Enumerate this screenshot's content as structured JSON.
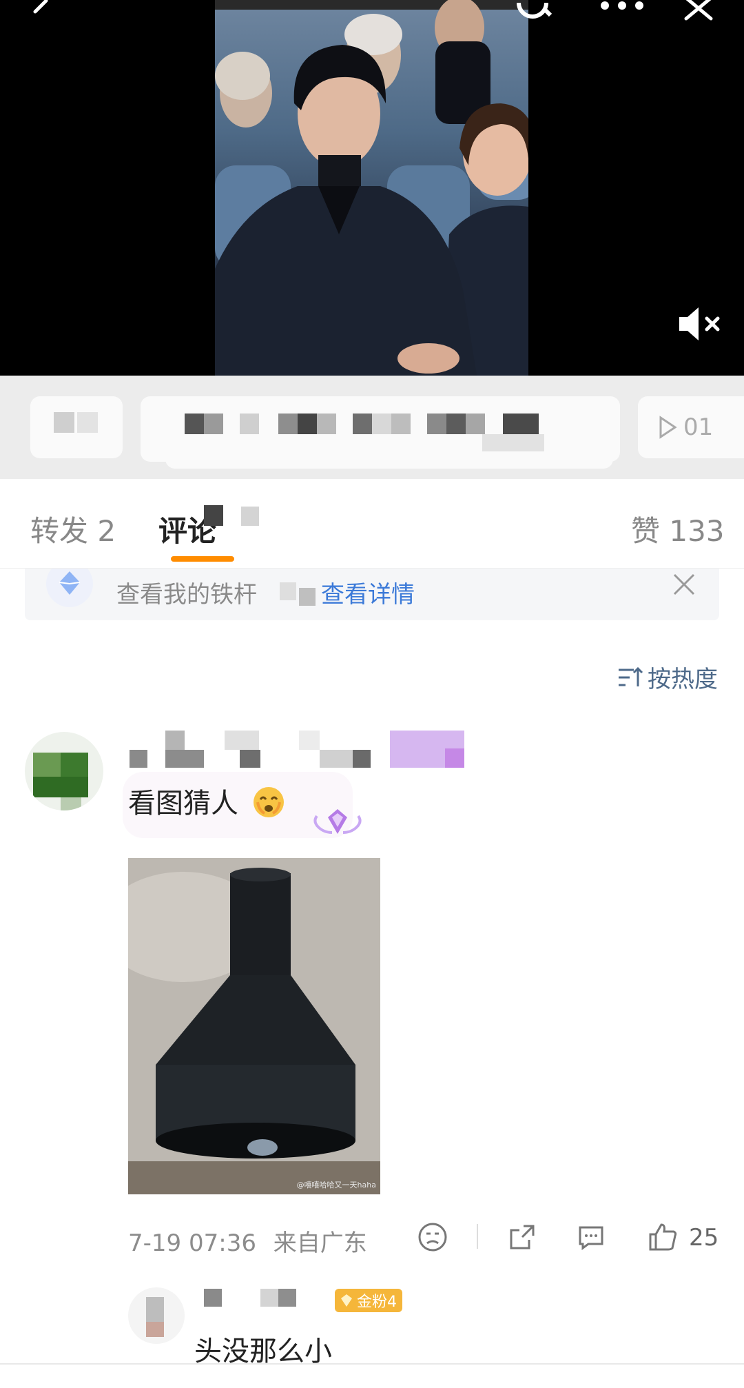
{
  "tabs": {
    "repost": "转发 2",
    "comment": "评论",
    "likes": "赞 133"
  },
  "banner": {
    "text": "查看我的铁杆",
    "link": "查看详情"
  },
  "sort": {
    "label": "按热度"
  },
  "video": {
    "duration_prefix": "01"
  },
  "comment": {
    "text": "看图猜人",
    "image_watermark": "@嘻嘻哈哈又一天haha",
    "time": "7-19 07:36",
    "location": "来自广东",
    "like_count": "25"
  },
  "reply": {
    "badge": "金粉4",
    "text": "头没那么小"
  },
  "colors": {
    "accent": "#ff8c00",
    "link": "#3c7ad8",
    "badge": "#f5b63a"
  }
}
